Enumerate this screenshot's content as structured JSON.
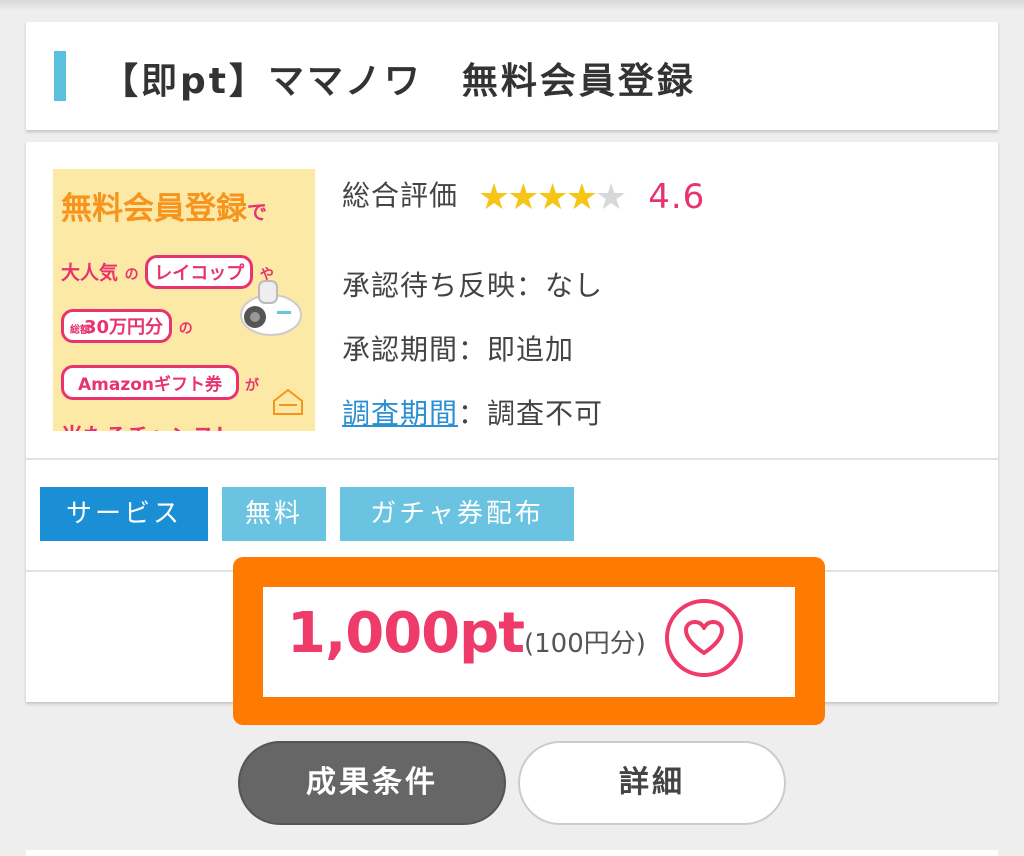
{
  "title": "【即pt】ママノワ　無料会員登録",
  "banner": {
    "line1": "無料会員登録",
    "line1_suffix": "で",
    "line2_pre": "大人気",
    "line2_no": "の",
    "line2_pill": "レイコップ",
    "line2_suffix": "や",
    "line3_mini": "総額",
    "line3_pill": "30万円分",
    "line3_no": "の",
    "line4_pill": "Amazonギフト券",
    "line4_suffix": "が",
    "line5": "当たるチャンス！"
  },
  "info": {
    "rating_label": "総合評価",
    "rating_value": "4.6",
    "rating_stars": 4,
    "approval_wait": "承認待ち反映：なし",
    "approval_period": "承認期間：即追加",
    "survey_link": "調査期間",
    "survey_value": "：調査不可"
  },
  "tags": [
    "サービス",
    "無料",
    "ガチャ券配布"
  ],
  "points": {
    "value": "1,000pt",
    "yen": "(100円分)"
  },
  "buttons": {
    "conditions": "成果条件",
    "details": "詳細"
  },
  "colors": {
    "accent_pink": "#ee3b6a",
    "highlight_orange": "#ff7a00",
    "tag_blue": "#1a8fd6",
    "tag_light_blue": "#6ac3e0"
  }
}
